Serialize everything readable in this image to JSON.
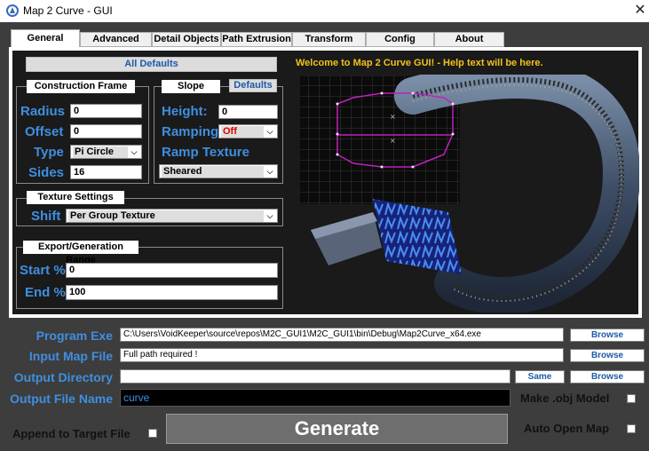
{
  "window": {
    "title": "Map 2 Curve - GUI"
  },
  "tabs": [
    {
      "label": "General"
    },
    {
      "label": "Advanced"
    },
    {
      "label": "Detail Objects"
    },
    {
      "label": "Path Extrusion"
    },
    {
      "label": "Transform"
    },
    {
      "label": "Config"
    },
    {
      "label": "About"
    }
  ],
  "general": {
    "all_defaults": "All Defaults",
    "welcome": "Welcome to Map 2 Curve GUI!  -  Help text will be here.",
    "construction": {
      "title": "Construction Frame",
      "radius_label": "Radius",
      "radius": "0",
      "offset_label": "Offset",
      "offset": "0",
      "type_label": "Type",
      "type": "Pi Circle",
      "sides_label": "Sides",
      "sides": "16"
    },
    "slope": {
      "title": "Slope",
      "defaults": "Defaults",
      "height_label": "Height:",
      "height": "0",
      "ramping_label": "Ramping",
      "ramping": "Off",
      "ramp_texture_label": "Ramp Texture",
      "ramp_texture": "Sheared"
    },
    "texture": {
      "title": "Texture Settings",
      "shift_label": "Shift",
      "shift": "Per Group Texture"
    },
    "export": {
      "title": "Export/Generation Range",
      "start_label": "Start %",
      "start": "0",
      "end_label": "End %",
      "end": "100"
    }
  },
  "bottom": {
    "program_exe_label": "Program Exe",
    "program_exe": "C:\\Users\\VoidKeeper\\source\\repos\\M2C_GUI1\\M2C_GUI1\\bin\\Debug\\Map2Curve_x64.exe",
    "input_map_label": "Input Map File",
    "input_map": "Full path required !",
    "output_dir_label": "Output Directory",
    "output_dir": "",
    "output_name_label": "Output File Name",
    "output_name": "curve",
    "browse": "Browse",
    "same": "Same",
    "make_obj": "Make .obj Model",
    "append": "Append to Target File",
    "auto_open": "Auto Open Map",
    "generate": "Generate"
  },
  "colors": {
    "accent_blue": "#3f8fe0",
    "welcome_yellow": "#f2c21b",
    "magenta": "#c020c0"
  }
}
